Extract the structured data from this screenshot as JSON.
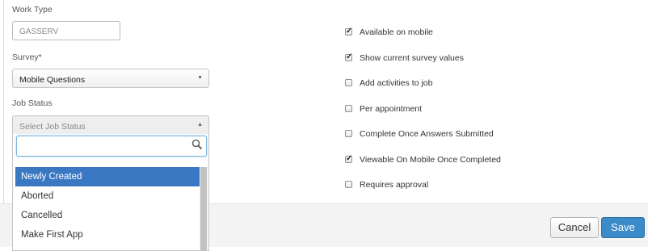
{
  "work_type": {
    "label": "Work Type",
    "value": "GASSERV"
  },
  "survey": {
    "label": "Survey*",
    "selected": "Mobile Questions"
  },
  "job_status": {
    "label": "Job Status",
    "placeholder": "Select Job Status",
    "search_value": "",
    "options": [
      "Newly Created",
      "Aborted",
      "Cancelled",
      "Make First App"
    ],
    "highlighted_option": "Newly Created"
  },
  "checkboxes": [
    {
      "label": "Available on mobile",
      "checked": true
    },
    {
      "label": "Show current survey values",
      "checked": true
    },
    {
      "label": "Add activities to job",
      "checked": false
    },
    {
      "label": "Per appointment",
      "checked": false
    },
    {
      "label": "Complete Once Answers Submitted",
      "checked": false
    },
    {
      "label": "Viewable On Mobile Once Completed",
      "checked": true
    },
    {
      "label": "Requires approval",
      "checked": false
    }
  ],
  "footer": {
    "cancel_label": "Cancel",
    "save_label": "Save"
  },
  "colors": {
    "accent": "#3a78c3",
    "save_button": "#3a8bc8"
  },
  "icons": {
    "search": "search-icon",
    "dropdown_arrow": "caret-down-icon",
    "dropdown_open_arrow": "caret-up-icon",
    "check": "checkmark-icon"
  }
}
